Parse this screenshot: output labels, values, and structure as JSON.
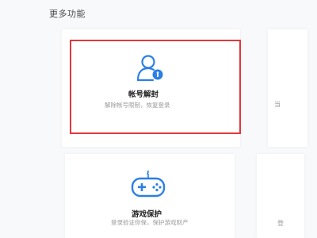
{
  "section": {
    "title": "更多功能"
  },
  "cards": [
    {
      "label": "帐号解封",
      "description": "解除帐号限制，恢复登录",
      "icon": "user-unlock-icon",
      "highlighted": true
    },
    {
      "label": "游戏保护",
      "description": "登录验证你保，保护游戏财产",
      "icon": "gamepad-icon",
      "highlighted": false
    }
  ],
  "partial_cards": {
    "top_glyph": "当",
    "bottom_glyph": "登"
  },
  "colors": {
    "accent": "#2b7fe6",
    "highlight_border": "#e0393e",
    "background": "#f8f9fb",
    "card": "#ffffff"
  }
}
